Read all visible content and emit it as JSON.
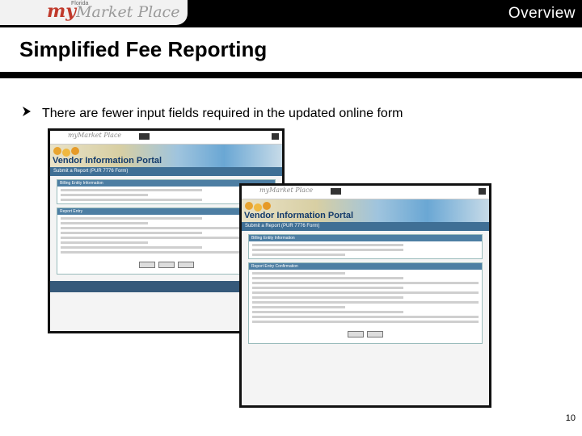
{
  "header": {
    "logo_my": "my",
    "logo_florida": "Florida",
    "logo_marketplace": "Market Place",
    "section_label": "Overview"
  },
  "slide": {
    "title": "Simplified Fee Reporting",
    "bullet": "There are fewer input fields required in the updated online form",
    "page_number": "10"
  },
  "screenshot_back": {
    "portal_title": "Vendor Information Portal",
    "subtitle": "Submit a Report (PUR 7776 Form)",
    "panels": [
      "Billing Entity Information",
      "Report Entry"
    ]
  },
  "screenshot_front": {
    "portal_title": "Vendor Information Portal",
    "subtitle": "Submit a Report (PUR 7776 Form)",
    "panels": [
      "Billing Entity Information",
      "Report Entry Confirmation"
    ]
  }
}
